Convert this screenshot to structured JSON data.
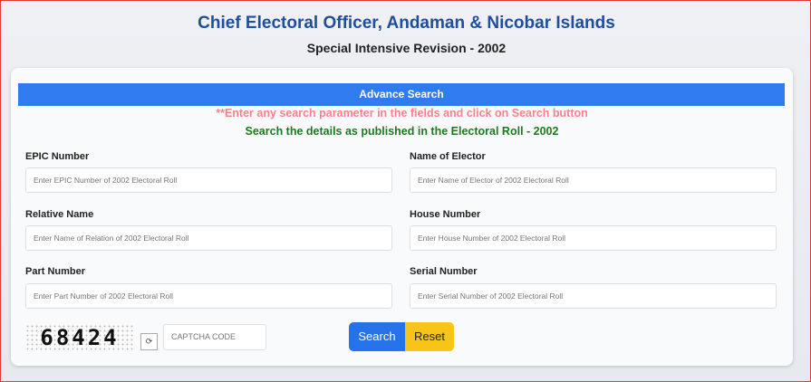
{
  "header": {
    "title": "Chief Electoral Officer, Andaman & Nicobar Islands",
    "subtitle": "Special Intensive Revision - 2002"
  },
  "search": {
    "bar_title": "Advance Search",
    "instruction": "**Enter any search parameter in the fields and click on Search button",
    "published_note": "Search the details as published in the Electoral Roll - 2002"
  },
  "fields": {
    "epic": {
      "label": "EPIC Number",
      "placeholder": "Enter EPIC Number of 2002 Electoral Roll"
    },
    "elector_name": {
      "label": "Name of Elector",
      "placeholder": "Enter Name of Elector of 2002 Electoral Roll"
    },
    "relative_name": {
      "label": "Relative Name",
      "placeholder": "Enter Name of Relation of 2002 Electoral Roll"
    },
    "house_number": {
      "label": "House Number",
      "placeholder": "Enter House Number of 2002 Electoral Roll"
    },
    "part_number": {
      "label": "Part Number",
      "placeholder": "Enter Part Number of 2002 Electoral Roll"
    },
    "serial_number": {
      "label": "Serial Number",
      "placeholder": "Enter Serial Number of 2002 Electoral Roll"
    }
  },
  "captcha": {
    "code": "68424",
    "placeholder": "CAPTCHA CODE",
    "refresh_icon": "refresh-icon"
  },
  "buttons": {
    "search": "Search",
    "reset": "Reset"
  },
  "colors": {
    "title": "#1f4e9e",
    "bar": "#2f7bef",
    "instruction": "#ff7f8f",
    "published_note": "#1e7a1e",
    "search_button": "#2672e8",
    "reset_button": "#f7c51a",
    "frame_border": "#e53935"
  }
}
